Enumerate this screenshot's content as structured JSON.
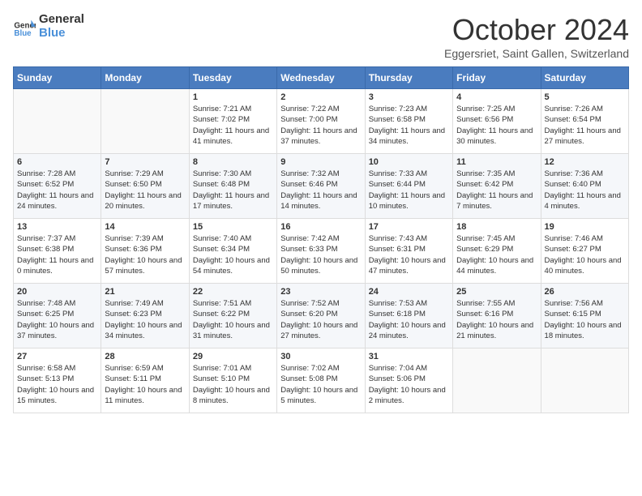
{
  "header": {
    "logo_line1": "General",
    "logo_line2": "Blue",
    "month": "October 2024",
    "location": "Eggersriet, Saint Gallen, Switzerland"
  },
  "days_of_week": [
    "Sunday",
    "Monday",
    "Tuesday",
    "Wednesday",
    "Thursday",
    "Friday",
    "Saturday"
  ],
  "weeks": [
    [
      {
        "day": "",
        "info": ""
      },
      {
        "day": "",
        "info": ""
      },
      {
        "day": "1",
        "info": "Sunrise: 7:21 AM\nSunset: 7:02 PM\nDaylight: 11 hours and 41 minutes."
      },
      {
        "day": "2",
        "info": "Sunrise: 7:22 AM\nSunset: 7:00 PM\nDaylight: 11 hours and 37 minutes."
      },
      {
        "day": "3",
        "info": "Sunrise: 7:23 AM\nSunset: 6:58 PM\nDaylight: 11 hours and 34 minutes."
      },
      {
        "day": "4",
        "info": "Sunrise: 7:25 AM\nSunset: 6:56 PM\nDaylight: 11 hours and 30 minutes."
      },
      {
        "day": "5",
        "info": "Sunrise: 7:26 AM\nSunset: 6:54 PM\nDaylight: 11 hours and 27 minutes."
      }
    ],
    [
      {
        "day": "6",
        "info": "Sunrise: 7:28 AM\nSunset: 6:52 PM\nDaylight: 11 hours and 24 minutes."
      },
      {
        "day": "7",
        "info": "Sunrise: 7:29 AM\nSunset: 6:50 PM\nDaylight: 11 hours and 20 minutes."
      },
      {
        "day": "8",
        "info": "Sunrise: 7:30 AM\nSunset: 6:48 PM\nDaylight: 11 hours and 17 minutes."
      },
      {
        "day": "9",
        "info": "Sunrise: 7:32 AM\nSunset: 6:46 PM\nDaylight: 11 hours and 14 minutes."
      },
      {
        "day": "10",
        "info": "Sunrise: 7:33 AM\nSunset: 6:44 PM\nDaylight: 11 hours and 10 minutes."
      },
      {
        "day": "11",
        "info": "Sunrise: 7:35 AM\nSunset: 6:42 PM\nDaylight: 11 hours and 7 minutes."
      },
      {
        "day": "12",
        "info": "Sunrise: 7:36 AM\nSunset: 6:40 PM\nDaylight: 11 hours and 4 minutes."
      }
    ],
    [
      {
        "day": "13",
        "info": "Sunrise: 7:37 AM\nSunset: 6:38 PM\nDaylight: 11 hours and 0 minutes."
      },
      {
        "day": "14",
        "info": "Sunrise: 7:39 AM\nSunset: 6:36 PM\nDaylight: 10 hours and 57 minutes."
      },
      {
        "day": "15",
        "info": "Sunrise: 7:40 AM\nSunset: 6:34 PM\nDaylight: 10 hours and 54 minutes."
      },
      {
        "day": "16",
        "info": "Sunrise: 7:42 AM\nSunset: 6:33 PM\nDaylight: 10 hours and 50 minutes."
      },
      {
        "day": "17",
        "info": "Sunrise: 7:43 AM\nSunset: 6:31 PM\nDaylight: 10 hours and 47 minutes."
      },
      {
        "day": "18",
        "info": "Sunrise: 7:45 AM\nSunset: 6:29 PM\nDaylight: 10 hours and 44 minutes."
      },
      {
        "day": "19",
        "info": "Sunrise: 7:46 AM\nSunset: 6:27 PM\nDaylight: 10 hours and 40 minutes."
      }
    ],
    [
      {
        "day": "20",
        "info": "Sunrise: 7:48 AM\nSunset: 6:25 PM\nDaylight: 10 hours and 37 minutes."
      },
      {
        "day": "21",
        "info": "Sunrise: 7:49 AM\nSunset: 6:23 PM\nDaylight: 10 hours and 34 minutes."
      },
      {
        "day": "22",
        "info": "Sunrise: 7:51 AM\nSunset: 6:22 PM\nDaylight: 10 hours and 31 minutes."
      },
      {
        "day": "23",
        "info": "Sunrise: 7:52 AM\nSunset: 6:20 PM\nDaylight: 10 hours and 27 minutes."
      },
      {
        "day": "24",
        "info": "Sunrise: 7:53 AM\nSunset: 6:18 PM\nDaylight: 10 hours and 24 minutes."
      },
      {
        "day": "25",
        "info": "Sunrise: 7:55 AM\nSunset: 6:16 PM\nDaylight: 10 hours and 21 minutes."
      },
      {
        "day": "26",
        "info": "Sunrise: 7:56 AM\nSunset: 6:15 PM\nDaylight: 10 hours and 18 minutes."
      }
    ],
    [
      {
        "day": "27",
        "info": "Sunrise: 6:58 AM\nSunset: 5:13 PM\nDaylight: 10 hours and 15 minutes."
      },
      {
        "day": "28",
        "info": "Sunrise: 6:59 AM\nSunset: 5:11 PM\nDaylight: 10 hours and 11 minutes."
      },
      {
        "day": "29",
        "info": "Sunrise: 7:01 AM\nSunset: 5:10 PM\nDaylight: 10 hours and 8 minutes."
      },
      {
        "day": "30",
        "info": "Sunrise: 7:02 AM\nSunset: 5:08 PM\nDaylight: 10 hours and 5 minutes."
      },
      {
        "day": "31",
        "info": "Sunrise: 7:04 AM\nSunset: 5:06 PM\nDaylight: 10 hours and 2 minutes."
      },
      {
        "day": "",
        "info": ""
      },
      {
        "day": "",
        "info": ""
      }
    ]
  ]
}
